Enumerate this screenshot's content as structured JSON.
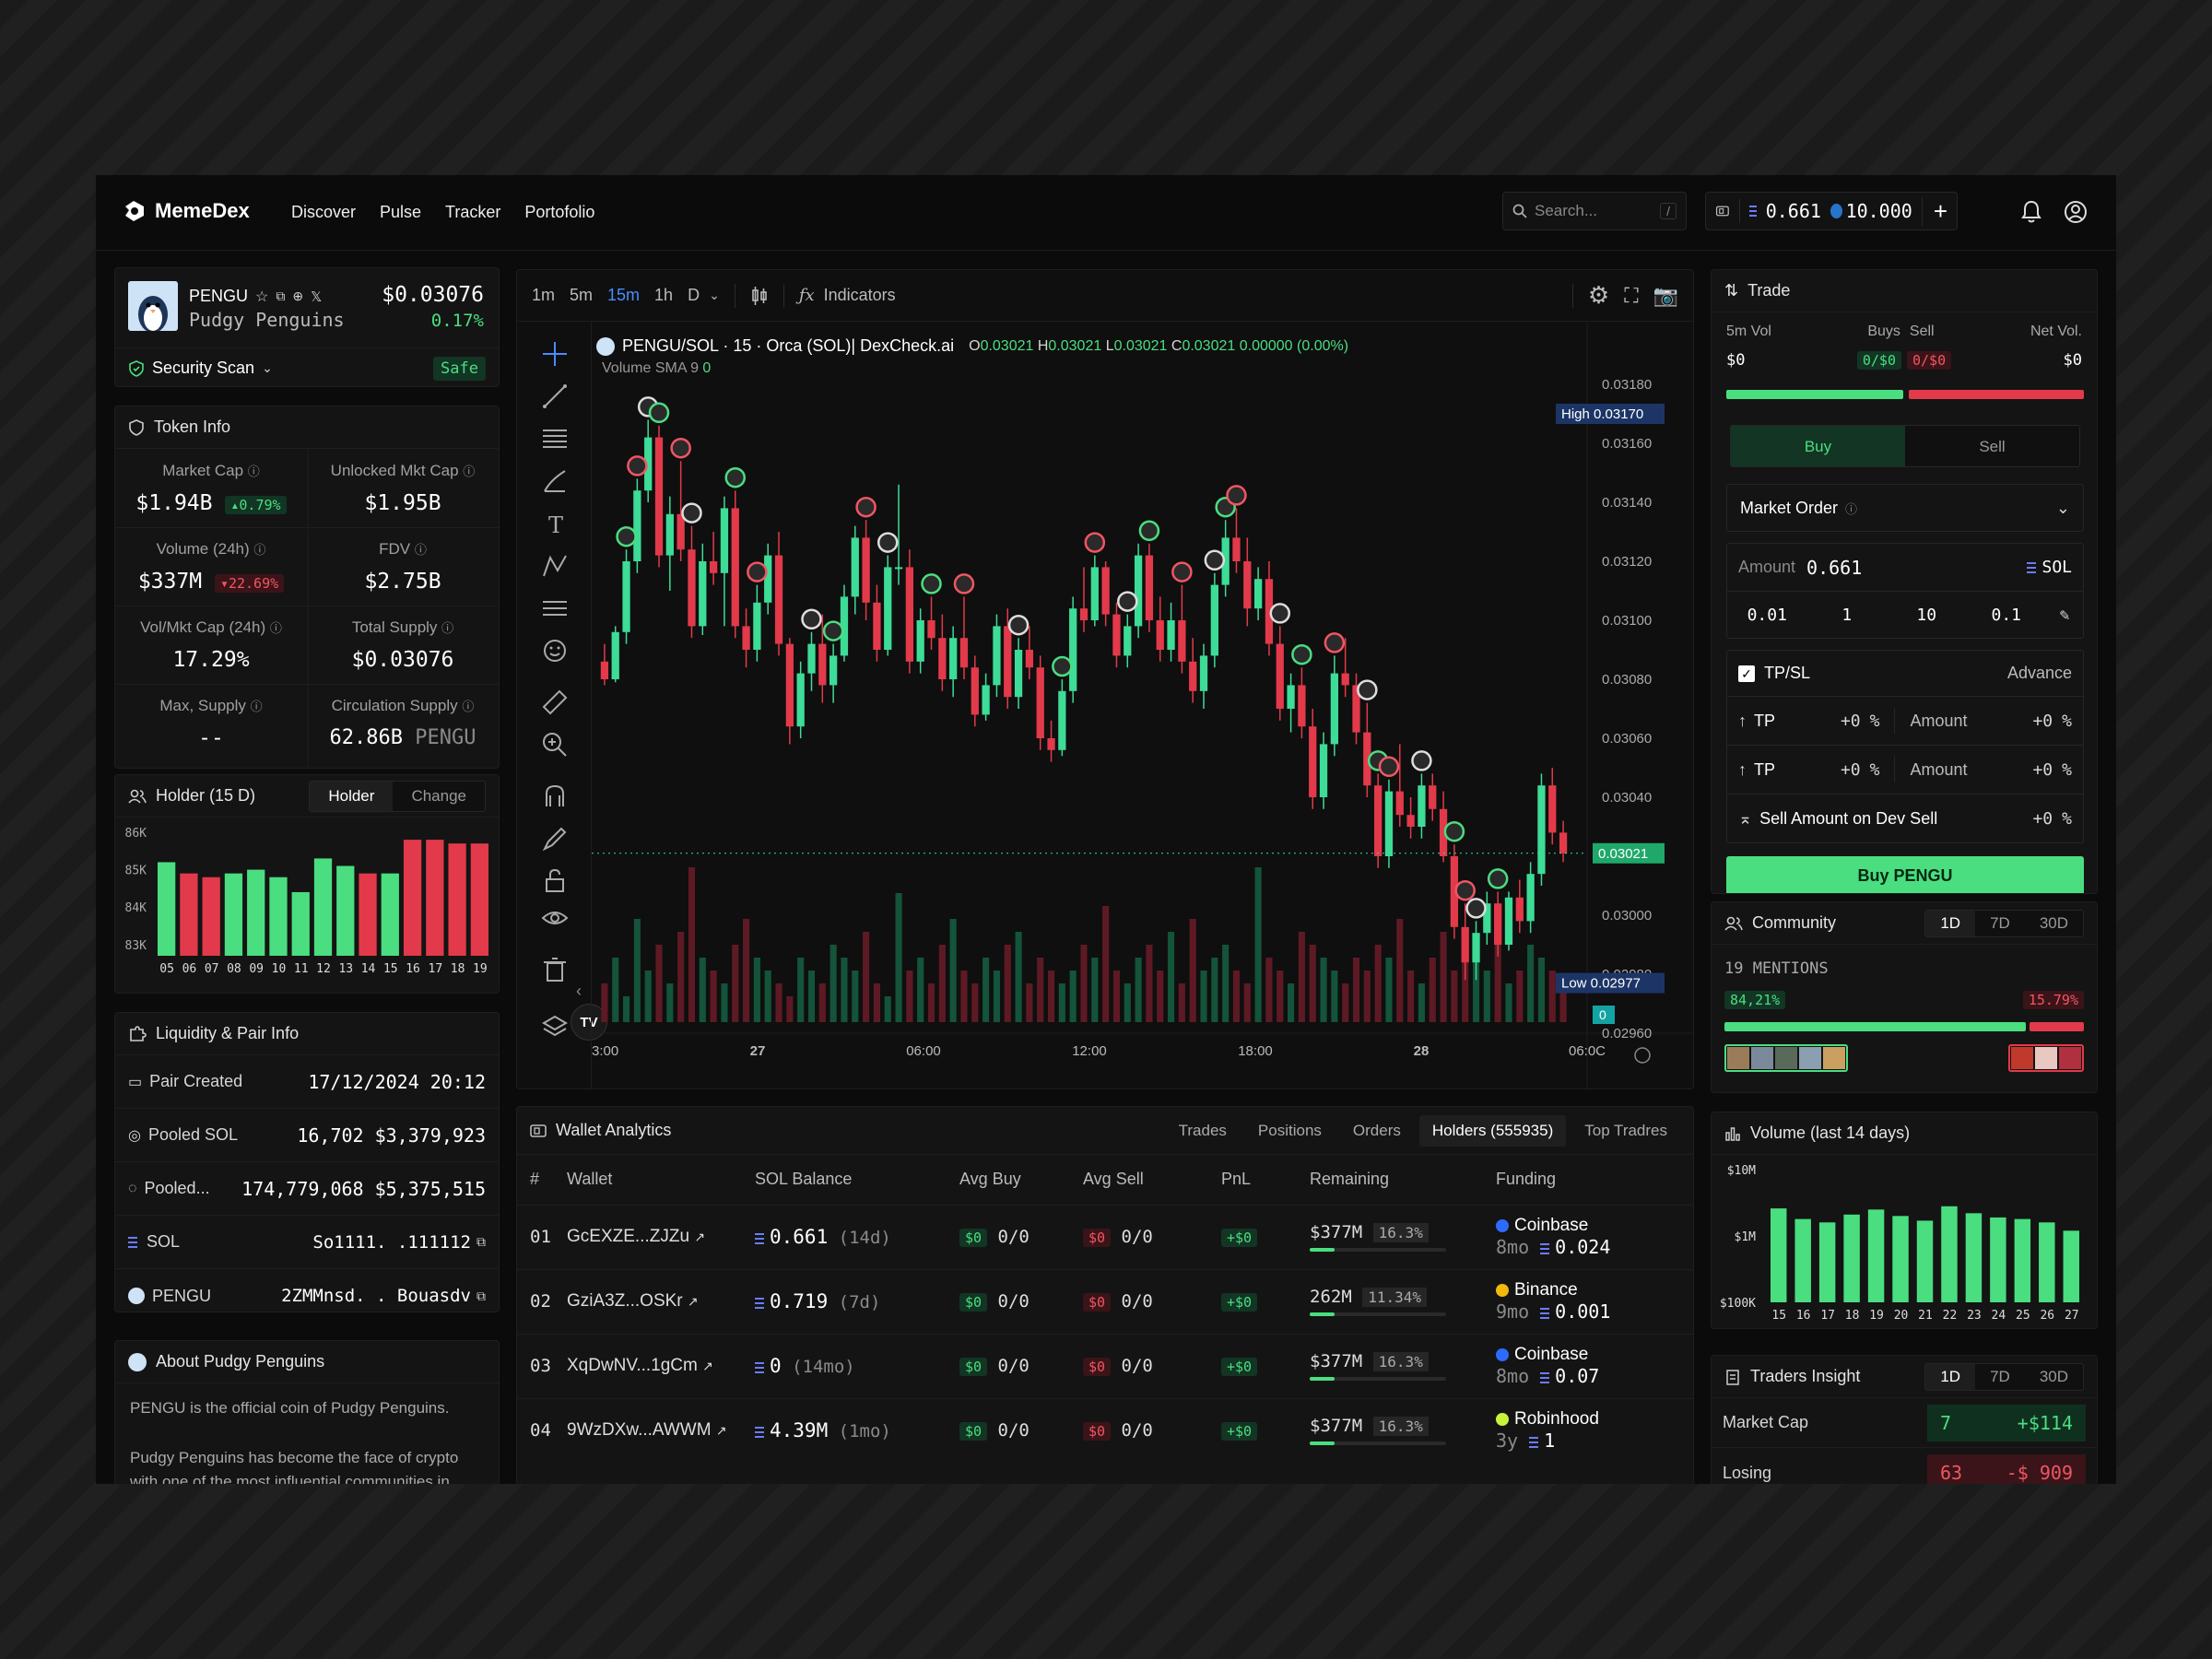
{
  "app": {
    "name": "MemeDex",
    "nav": [
      "Discover",
      "Pulse",
      "Tracker",
      "Portofolio"
    ],
    "search_placeholder": "Search...",
    "search_kbd": "/",
    "wallet_sol": "0.661",
    "wallet_usdc": "10.000"
  },
  "token": {
    "symbol": "PENGU",
    "name": "Pudgy Penguins",
    "price": "$0.03076",
    "change": "0.17%",
    "security": "Security Scan",
    "security_badge": "Safe"
  },
  "token_info": {
    "title": "Token Info",
    "items": [
      {
        "label": "Market Cap",
        "value": "$1.94B",
        "badge": "0.79%",
        "badge_type": "up"
      },
      {
        "label": "Unlocked Mkt Cap",
        "value": "$1.95B"
      },
      {
        "label": "Volume (24h)",
        "value": "$337M",
        "badge": "22.69%",
        "badge_type": "down"
      },
      {
        "label": "FDV",
        "value": "$2.75B"
      },
      {
        "label": "Vol/Mkt Cap (24h)",
        "value": "17.29%"
      },
      {
        "label": "Total Supply",
        "value": "$0.03076"
      },
      {
        "label": "Max, Supply",
        "value": "--"
      },
      {
        "label": "Circulation Supply",
        "value": "62.86B",
        "value_suffix": "PENGU"
      }
    ]
  },
  "holder": {
    "title": "Holder (15 D)",
    "tabs": [
      "Holder",
      "Change"
    ],
    "ylabels": [
      "86K",
      "85K",
      "84K",
      "83K"
    ],
    "xlabels": [
      "05",
      "06",
      "07",
      "08",
      "09",
      "10",
      "11",
      "12",
      "13",
      "14",
      "15",
      "16",
      "17",
      "18",
      "19"
    ],
    "values": [
      85.2,
      84.9,
      84.8,
      84.9,
      85.0,
      84.8,
      84.4,
      85.3,
      85.1,
      84.9,
      84.9,
      85.8,
      85.8,
      85.7,
      85.7
    ],
    "colors": [
      "g",
      "r",
      "r",
      "g",
      "g",
      "g",
      "g",
      "g",
      "g",
      "r",
      "g",
      "r",
      "r",
      "r",
      "r"
    ]
  },
  "liquidity": {
    "title": "Liquidity & Pair Info",
    "rows": [
      {
        "label": "Pair Created",
        "value": "17/12/2024 20:12"
      },
      {
        "label": "Pooled SOL",
        "value": "16,702",
        "value2": "$3,379,923"
      },
      {
        "label": "Pooled...",
        "value": "174,779,068",
        "value2": "$5,375,515"
      },
      {
        "label": "SOL",
        "value": "So1111. .111112"
      },
      {
        "label": "PENGU",
        "value": "2ZMMnsd. . Bouasdv"
      }
    ]
  },
  "about": {
    "title": "About Pudgy Penguins",
    "p1": "PENGU is the official coin of Pudgy Penguins.",
    "p2": "Pudgy Penguins has become the face of crypto with one of the most influential communities in"
  },
  "chart": {
    "timeframes": [
      "1m",
      "5m",
      "15m",
      "1h",
      "D"
    ],
    "active_tf": "15m",
    "indicators": "Indicators",
    "pair_title": "PENGU/SOL · 15 · Orca (SOL)| DexCheck.ai",
    "ohlc": {
      "o": "0.03021",
      "h": "0.03021",
      "l": "0.03021",
      "c": "0.03021",
      "chg": "0.00000 (0.00%)"
    },
    "volume_label": "Volume",
    "sma_label": "SMA 9",
    "sma_value": "0",
    "high_label": "High",
    "high_value": "0.03170",
    "low_label": "Low",
    "low_value": "0.02977",
    "last_price": "0.03021",
    "vol_marker": "0",
    "yticks": [
      "0.03180",
      "0.03160",
      "0.03140",
      "0.03120",
      "0.03100",
      "0.03080",
      "0.03060",
      "0.03040",
      "0.03020",
      "0.03000",
      "0.02980",
      "0.02960"
    ],
    "xticks": [
      "3:00",
      "27",
      "06:00",
      "12:00",
      "18:00",
      "28",
      "06:0C"
    ]
  },
  "chart_data": {
    "type": "candlestick",
    "title": "PENGU/SOL · 15 · Orca (SOL)| DexCheck.ai",
    "ylim": [
      0.0296,
      0.0319
    ],
    "candles": [
      [
        0.03086,
        0.03092,
        0.03078,
        0.0308
      ],
      [
        0.0308,
        0.03098,
        0.03079,
        0.03096
      ],
      [
        0.03096,
        0.03124,
        0.03092,
        0.0312
      ],
      [
        0.0312,
        0.03148,
        0.03116,
        0.03144
      ],
      [
        0.03144,
        0.03168,
        0.0314,
        0.03162
      ],
      [
        0.03162,
        0.03166,
        0.03118,
        0.03122
      ],
      [
        0.03122,
        0.03142,
        0.0311,
        0.03136
      ],
      [
        0.03136,
        0.03154,
        0.0312,
        0.03124
      ],
      [
        0.03124,
        0.03132,
        0.03094,
        0.03098
      ],
      [
        0.03098,
        0.03126,
        0.03095,
        0.0312
      ],
      [
        0.0312,
        0.0313,
        0.03112,
        0.03116
      ],
      [
        0.03116,
        0.03142,
        0.03098,
        0.03138
      ],
      [
        0.03138,
        0.03144,
        0.03094,
        0.03098
      ],
      [
        0.03098,
        0.03104,
        0.03084,
        0.0309
      ],
      [
        0.0309,
        0.03112,
        0.03086,
        0.03106
      ],
      [
        0.03106,
        0.03126,
        0.03102,
        0.03122
      ],
      [
        0.03122,
        0.0313,
        0.03088,
        0.03092
      ],
      [
        0.03092,
        0.03094,
        0.03058,
        0.03064
      ],
      [
        0.03064,
        0.03086,
        0.0306,
        0.03082
      ],
      [
        0.03082,
        0.03096,
        0.03076,
        0.03092
      ],
      [
        0.03092,
        0.03102,
        0.03072,
        0.03078
      ],
      [
        0.03078,
        0.03092,
        0.03072,
        0.03088
      ],
      [
        0.03088,
        0.03112,
        0.03086,
        0.03108
      ],
      [
        0.03108,
        0.03132,
        0.03102,
        0.03128
      ],
      [
        0.03128,
        0.03134,
        0.031,
        0.03106
      ],
      [
        0.03106,
        0.03112,
        0.03086,
        0.0309
      ],
      [
        0.0309,
        0.03122,
        0.03088,
        0.03118
      ],
      [
        0.03118,
        0.03146,
        0.03112,
        0.03118
      ],
      [
        0.03118,
        0.03124,
        0.03082,
        0.03086
      ],
      [
        0.03086,
        0.03104,
        0.03082,
        0.031
      ],
      [
        0.031,
        0.03108,
        0.0309,
        0.03094
      ],
      [
        0.03094,
        0.03102,
        0.03076,
        0.0308
      ],
      [
        0.0308,
        0.03098,
        0.03074,
        0.03094
      ],
      [
        0.03094,
        0.03108,
        0.0308,
        0.03084
      ],
      [
        0.03084,
        0.03088,
        0.03064,
        0.03068
      ],
      [
        0.03068,
        0.03082,
        0.03066,
        0.03078
      ],
      [
        0.03078,
        0.03102,
        0.03074,
        0.03098
      ],
      [
        0.03098,
        0.03104,
        0.0307,
        0.03074
      ],
      [
        0.03074,
        0.03094,
        0.0307,
        0.0309
      ],
      [
        0.0309,
        0.03098,
        0.0308,
        0.03084
      ],
      [
        0.03084,
        0.03088,
        0.03056,
        0.0306
      ],
      [
        0.0306,
        0.03066,
        0.03052,
        0.03056
      ],
      [
        0.03056,
        0.0308,
        0.03054,
        0.03076
      ],
      [
        0.03076,
        0.03108,
        0.03072,
        0.03104
      ],
      [
        0.03104,
        0.03118,
        0.03096,
        0.031
      ],
      [
        0.031,
        0.03122,
        0.03098,
        0.03118
      ],
      [
        0.03118,
        0.0312,
        0.03098,
        0.03102
      ],
      [
        0.03102,
        0.03106,
        0.03084,
        0.03088
      ],
      [
        0.03088,
        0.03102,
        0.03084,
        0.03098
      ],
      [
        0.03098,
        0.03126,
        0.03094,
        0.03122
      ],
      [
        0.03122,
        0.03126,
        0.03096,
        0.031
      ],
      [
        0.031,
        0.03108,
        0.03086,
        0.0309
      ],
      [
        0.0309,
        0.03106,
        0.03086,
        0.031
      ],
      [
        0.031,
        0.03112,
        0.03082,
        0.03086
      ],
      [
        0.03086,
        0.03094,
        0.03072,
        0.03076
      ],
      [
        0.03076,
        0.03092,
        0.0307,
        0.03088
      ],
      [
        0.03088,
        0.03116,
        0.03084,
        0.03112
      ],
      [
        0.03112,
        0.03134,
        0.03108,
        0.03128
      ],
      [
        0.03128,
        0.03138,
        0.03116,
        0.0312
      ],
      [
        0.0312,
        0.03128,
        0.03098,
        0.03104
      ],
      [
        0.03104,
        0.03118,
        0.031,
        0.03114
      ],
      [
        0.03114,
        0.0312,
        0.03088,
        0.03092
      ],
      [
        0.03092,
        0.03098,
        0.03066,
        0.0307
      ],
      [
        0.0307,
        0.03082,
        0.03062,
        0.03078
      ],
      [
        0.03078,
        0.03084,
        0.0306,
        0.03064
      ],
      [
        0.03064,
        0.0307,
        0.03036,
        0.0304
      ],
      [
        0.0304,
        0.03062,
        0.03036,
        0.03058
      ],
      [
        0.03058,
        0.03088,
        0.03054,
        0.03082
      ],
      [
        0.03082,
        0.03094,
        0.03074,
        0.03078
      ],
      [
        0.03078,
        0.03082,
        0.03058,
        0.03062
      ],
      [
        0.03062,
        0.03072,
        0.0304,
        0.03044
      ],
      [
        0.03044,
        0.03048,
        0.03016,
        0.0302
      ],
      [
        0.0302,
        0.03046,
        0.03016,
        0.03042
      ],
      [
        0.03042,
        0.03058,
        0.0303,
        0.03034
      ],
      [
        0.03034,
        0.0304,
        0.03026,
        0.0303
      ],
      [
        0.0303,
        0.03048,
        0.03026,
        0.03044
      ],
      [
        0.03044,
        0.03048,
        0.03032,
        0.03036
      ],
      [
        0.03036,
        0.03042,
        0.03018,
        0.0302
      ],
      [
        0.0302,
        0.03024,
        0.02992,
        0.02996
      ],
      [
        0.02996,
        0.03004,
        0.02978,
        0.02984
      ],
      [
        0.02984,
        0.02998,
        0.02978,
        0.02994
      ],
      [
        0.02994,
        0.03008,
        0.0299,
        0.03004
      ],
      [
        0.03004,
        0.03008,
        0.02986,
        0.0299
      ],
      [
        0.0299,
        0.03008,
        0.02988,
        0.03006
      ],
      [
        0.03006,
        0.03012,
        0.02994,
        0.02998
      ],
      [
        0.02998,
        0.03018,
        0.02994,
        0.03014
      ],
      [
        0.03014,
        0.03048,
        0.0301,
        0.03044
      ],
      [
        0.03044,
        0.0305,
        0.03024,
        0.03028
      ],
      [
        0.03028,
        0.03032,
        0.03018,
        0.03021
      ]
    ],
    "volume": [
      3,
      5,
      2,
      8,
      4,
      6,
      3,
      7,
      12,
      5,
      4,
      3,
      6,
      8,
      5,
      4,
      3,
      2,
      5,
      4,
      3,
      6,
      5,
      4,
      7,
      3,
      2,
      10,
      4,
      5,
      3,
      6,
      8,
      4,
      3,
      5,
      4,
      6,
      7,
      3,
      5,
      4,
      3,
      4,
      6,
      5,
      9,
      4,
      3,
      5,
      6,
      4,
      7,
      3,
      8,
      4,
      5,
      6,
      4,
      3,
      12,
      5,
      4,
      3,
      7,
      6,
      5,
      4,
      3,
      5,
      4,
      6,
      5,
      8,
      4,
      3,
      5,
      7,
      4,
      6,
      5,
      4,
      9,
      3,
      4,
      6,
      5,
      4,
      3
    ]
  },
  "trade": {
    "title": "Trade",
    "vol_label": "5m Vol",
    "buys_label": "Buys",
    "sells_label": "Sell",
    "net_label": "Net Vol.",
    "vol_value": "$0",
    "buys_value": "0/$0",
    "sells_value": "0/$0",
    "net_value": "$0",
    "tab_buy": "Buy",
    "tab_sell": "Sell",
    "order_type": "Market Order",
    "amount_label": "Amount",
    "amount_value": "0.661",
    "amount_unit": "SOL",
    "presets": [
      "0.01",
      "1",
      "10",
      "0.1"
    ],
    "tpsl": "TP/SL",
    "advance": "Advance",
    "tp_rows": [
      {
        "label": "TP",
        "value": "+0",
        "pct": "%",
        "amt_label": "Amount",
        "amt_value": "+0"
      },
      {
        "label": "TP",
        "value": "+0",
        "pct": "%",
        "amt_label": "Amount",
        "amt_value": "+0"
      }
    ],
    "dev_sell_label": "Sell Amount on Dev Sell",
    "dev_sell_value": "+0",
    "buy_button": "Buy PENGU"
  },
  "community": {
    "title": "Community",
    "tabs": [
      "1D",
      "7D",
      "30D"
    ],
    "mentions": "19 MENTIONS",
    "pos": "84,21%",
    "neg": "15.79%",
    "pos_frac": 0.842
  },
  "volume14": {
    "title": "Volume (last 14 days)",
    "ylabels": [
      "$10M",
      "$1M",
      "$100K"
    ],
    "xlabels": [
      "15",
      "16",
      "17",
      "18",
      "19",
      "20",
      "21",
      "22",
      "23",
      "24",
      "25",
      "26",
      "27"
    ],
    "values": [
      2.6,
      1.8,
      1.6,
      2.1,
      2.5,
      2.0,
      1.7,
      2.8,
      2.2,
      1.9,
      1.8,
      1.6,
      1.2
    ]
  },
  "traders": {
    "title": "Traders Insight",
    "tabs": [
      "1D",
      "7D",
      "30D"
    ],
    "rows": [
      {
        "label": "Market Cap",
        "count": "7",
        "value": "+$114",
        "type": "up"
      },
      {
        "label": "Losing",
        "count": "63",
        "value": "-$ 909",
        "type": "down"
      }
    ]
  },
  "wallet_analytics": {
    "title": "Wallet Analytics",
    "tabs": [
      "Trades",
      "Positions",
      "Orders",
      "Holders (555935)",
      "Top Tradres"
    ],
    "active_tab": "Holders (555935)",
    "columns": [
      "#",
      "Wallet",
      "SOL Balance",
      "Avg Buy",
      "Avg Sell",
      "PnL",
      "Remaining",
      "Funding"
    ],
    "rows": [
      {
        "n": "01",
        "wallet": "GcEXZE...ZJZu",
        "sol": "0.661",
        "age": "(14d)",
        "buy_usd": "$0",
        "buy": "0/0",
        "sell_usd": "$0",
        "sell": "0/0",
        "pnl": "+$0",
        "remaining": "$377M",
        "pct": "16.3%",
        "fund": "Coinbase",
        "fund_age": "8mo",
        "fund_amt": "0.024",
        "fund_color": "#2d6bff"
      },
      {
        "n": "02",
        "wallet": "GziA3Z...OSKr",
        "sol": "0.719",
        "age": "(7d)",
        "buy_usd": "$0",
        "buy": "0/0",
        "sell_usd": "$0",
        "sell": "0/0",
        "pnl": "+$0",
        "remaining": "262M",
        "pct": "11.34%",
        "fund": "Binance",
        "fund_age": "9mo",
        "fund_amt": "0.001",
        "fund_color": "#f0b90b"
      },
      {
        "n": "03",
        "wallet": "XqDwNV...1gCm",
        "sol": "0",
        "age": "(14mo)",
        "buy_usd": "$0",
        "buy": "0/0",
        "sell_usd": "$0",
        "sell": "0/0",
        "pnl": "+$0",
        "remaining": "$377M",
        "pct": "16.3%",
        "fund": "Coinbase",
        "fund_age": "8mo",
        "fund_amt": "0.07",
        "fund_color": "#2d6bff"
      },
      {
        "n": "04",
        "wallet": "9WzDXw...AWWM",
        "sol": "4.39M",
        "age": "(1mo)",
        "buy_usd": "$0",
        "buy": "0/0",
        "sell_usd": "$0",
        "sell": "0/0",
        "pnl": "+$0",
        "remaining": "$377M",
        "pct": "16.3%",
        "fund": "Robinhood",
        "fund_age": "3y",
        "fund_amt": "1",
        "fund_color": "#c7f33a"
      }
    ]
  }
}
